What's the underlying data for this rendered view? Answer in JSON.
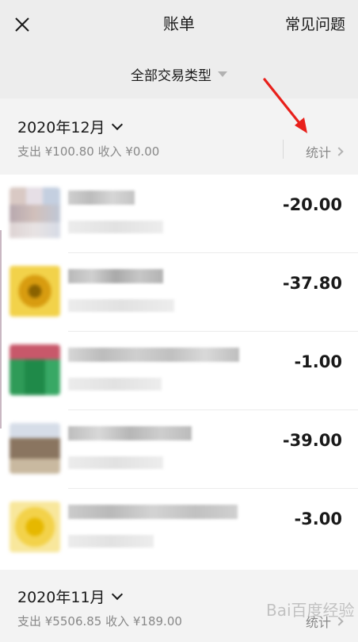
{
  "header": {
    "title": "账单",
    "faq_label": "常见问题",
    "close_icon": "close-icon"
  },
  "filter": {
    "label": "全部交易类型",
    "caret_icon": "caret-down-icon"
  },
  "months": [
    {
      "label": "2020年12月",
      "summary": "支出 ¥100.80  收入 ¥0.00",
      "stats_label": "统计"
    },
    {
      "label": "2020年11月",
      "summary": "支出 ¥5506.85  收入 ¥189.00",
      "stats_label": "统计"
    }
  ],
  "transactions": [
    {
      "amount": "-20.00",
      "icon": "merchant-avatar-icon"
    },
    {
      "amount": "-37.80",
      "icon": "merchant-avatar-icon"
    },
    {
      "amount": "-1.00",
      "icon": "merchant-avatar-icon"
    },
    {
      "amount": "-39.00",
      "icon": "merchant-avatar-icon"
    },
    {
      "amount": "-3.00",
      "icon": "merchant-avatar-icon"
    }
  ],
  "watermark": "Bai百度经验",
  "colors": {
    "background": "#ededed",
    "text": "#191919",
    "muted": "#888888",
    "annotation_arrow": "#e8201b"
  }
}
